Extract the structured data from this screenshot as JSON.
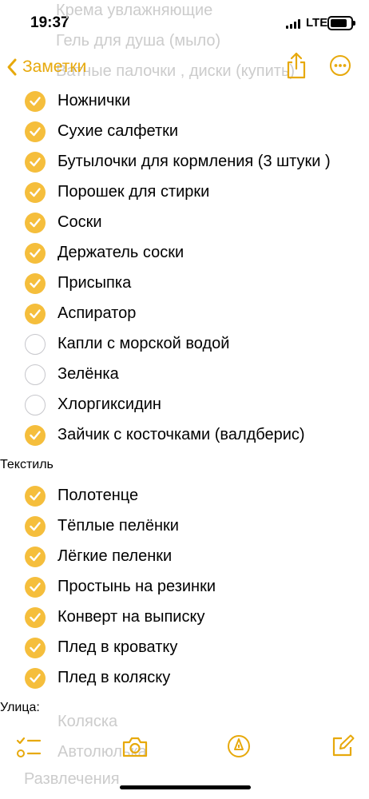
{
  "status_bar": {
    "time": "19:37",
    "network": "LTE"
  },
  "faded_above": [
    "Крема увлажняющие",
    "Гель для душа (мыло)",
    "Ватные палочки , диски (купить)"
  ],
  "nav": {
    "back_label": "Заметки"
  },
  "colors": {
    "accent": "#e7a90c",
    "check": "#f5be3c"
  },
  "items": [
    {
      "kind": "item",
      "text": "Ножнички",
      "checked": true
    },
    {
      "kind": "item",
      "text": "Сухие салфетки",
      "checked": true
    },
    {
      "kind": "item",
      "text": "Бутылочки для кормления (3 штуки )",
      "checked": true
    },
    {
      "kind": "item",
      "text": "Порошек для стирки",
      "checked": true
    },
    {
      "kind": "item",
      "text": "Соски",
      "checked": true
    },
    {
      "kind": "item",
      "text": "Держатель соски",
      "checked": true
    },
    {
      "kind": "item",
      "text": "Присыпка",
      "checked": true
    },
    {
      "kind": "item",
      "text": "Аспиратор",
      "checked": true
    },
    {
      "kind": "item",
      "text": "Капли с морской водой",
      "checked": false
    },
    {
      "kind": "item",
      "text": "Зелёнка",
      "checked": false
    },
    {
      "kind": "item",
      "text": "Хлоргиксидин",
      "checked": false
    },
    {
      "kind": "item",
      "text": "Зайчик с косточками (валдберис)",
      "checked": true
    },
    {
      "kind": "heading",
      "text": "Текстиль"
    },
    {
      "kind": "item",
      "text": "Полотенце",
      "checked": true
    },
    {
      "kind": "item",
      "text": "Тёплые пелёнки",
      "checked": true
    },
    {
      "kind": "item",
      "text": "Лёгкие пеленки",
      "checked": true
    },
    {
      "kind": "item",
      "text": "Простынь на резинки",
      "checked": true
    },
    {
      "kind": "item",
      "text": "Конверт на выписку",
      "checked": true
    },
    {
      "kind": "item",
      "text": "Плед в кроватку",
      "checked": true
    },
    {
      "kind": "item",
      "text": "Плед в коляску",
      "checked": true
    },
    {
      "kind": "heading",
      "text": "Улица:"
    }
  ],
  "faded_below": [
    "Коляска",
    "Автолюлька",
    "Развлечения"
  ]
}
